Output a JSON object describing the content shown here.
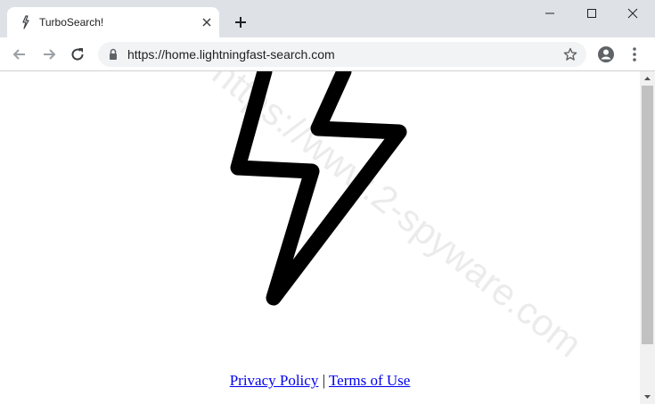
{
  "browser": {
    "tab": {
      "title": "TurboSearch!",
      "favicon": "lightning-icon"
    },
    "new_tab_icon": "plus-icon",
    "window_controls": [
      "minimize-icon",
      "maximize-icon",
      "close-icon"
    ],
    "toolbar": {
      "back_icon": "arrow-left-icon",
      "forward_icon": "arrow-right-icon",
      "reload_icon": "reload-icon",
      "url": "https://home.lightningfast-search.com",
      "lock_icon": "lock-icon",
      "bookmark_icon": "star-icon",
      "account_icon": "account-icon",
      "menu_icon": "kebab-menu-icon"
    }
  },
  "page": {
    "logo_icon": "lightning-bolt-icon",
    "footer": {
      "privacy_label": "Privacy Policy",
      "separator": "|",
      "terms_label": "Terms of Use"
    },
    "watermark": "https://www.2-spyware.com"
  },
  "colors": {
    "titlebar": "#dee1e6",
    "omnibox": "#f1f3f4",
    "link": "#0000ee",
    "scroll_thumb": "#c1c1c1"
  }
}
